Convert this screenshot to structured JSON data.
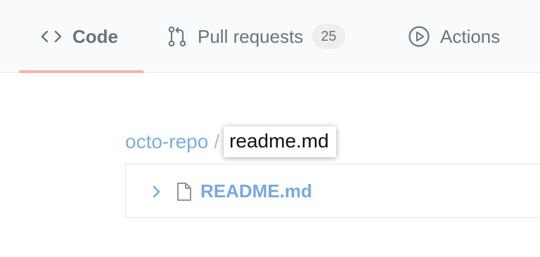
{
  "tabs": {
    "code": {
      "label": "Code",
      "icon": "code-icon"
    },
    "pulls": {
      "label": "Pull requests",
      "count": "25",
      "icon": "git-pull-request-icon"
    },
    "actions": {
      "label": "Actions",
      "icon": "play-circle-icon"
    }
  },
  "breadcrumb": {
    "repo": "octo-repo",
    "separator": "/",
    "filename_input": "readme.md"
  },
  "file_tree": {
    "items": [
      {
        "name": "README.md",
        "icon": "file-icon",
        "expand_icon": "chevron-right-icon"
      }
    ]
  },
  "colors": {
    "tab_underline": "#f9b3a0",
    "link": "#7aaee6",
    "muted": "#6a737d"
  }
}
